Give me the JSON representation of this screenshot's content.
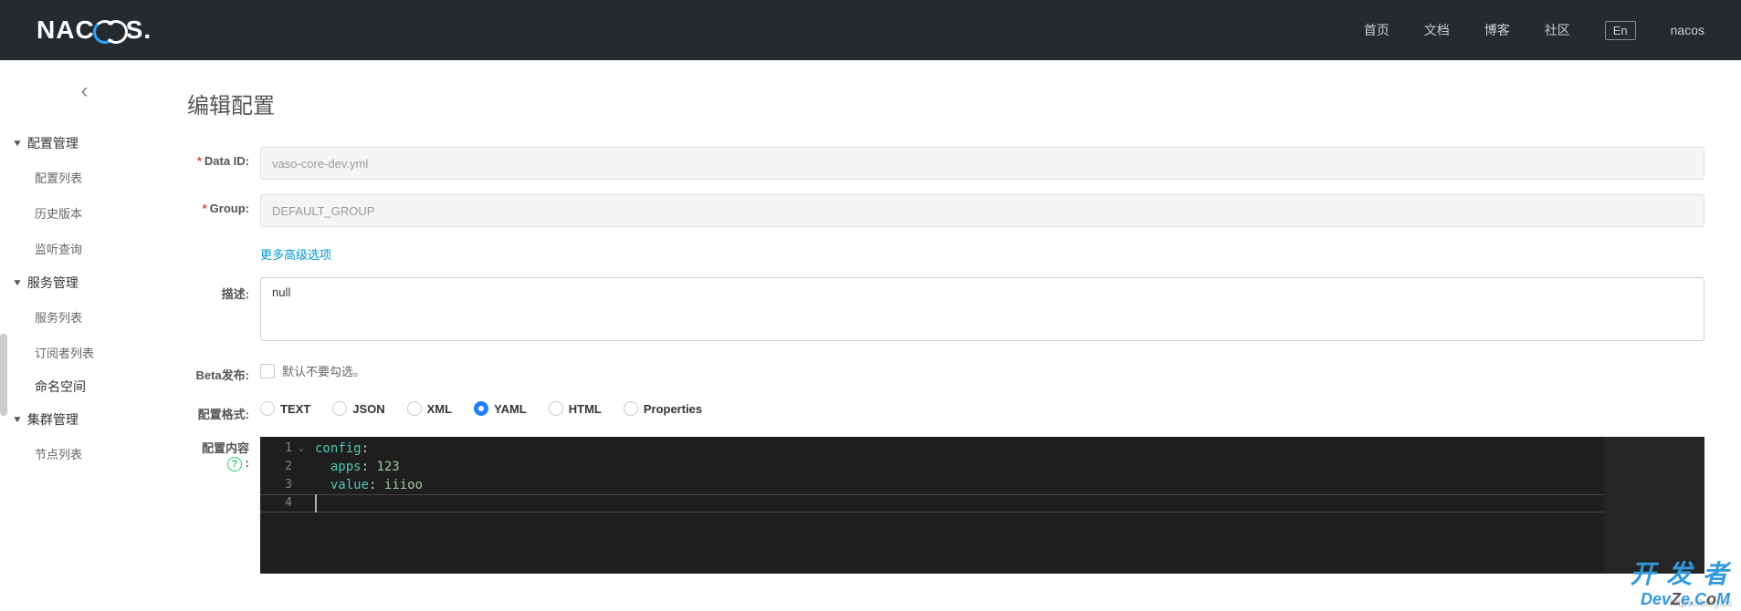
{
  "header": {
    "logo": "NACOS.",
    "nav": {
      "home": "首页",
      "docs": "文档",
      "blog": "博客",
      "community": "社区"
    },
    "lang": "En",
    "user": "nacos"
  },
  "sidebar": {
    "groups": [
      {
        "title": "配置管理",
        "items": [
          "配置列表",
          "历史版本",
          "监听查询"
        ]
      },
      {
        "title": "服务管理",
        "items": [
          "服务列表",
          "订阅者列表"
        ]
      }
    ],
    "namespace": "命名空间",
    "cluster": {
      "title": "集群管理",
      "items": [
        "节点列表"
      ]
    }
  },
  "page": {
    "title": "编辑配置",
    "labels": {
      "dataId": "Data ID:",
      "group": "Group:",
      "advanced": "更多高级选项",
      "desc": "描述:",
      "beta": "Beta发布:",
      "betaHint": "默认不要勾选。",
      "format": "配置格式:",
      "content": "配置内容"
    },
    "values": {
      "dataId": "vaso-core-dev.yml",
      "group": "DEFAULT_GROUP",
      "desc": "null"
    },
    "formats": [
      "TEXT",
      "JSON",
      "XML",
      "YAML",
      "HTML",
      "Properties"
    ],
    "formatSelected": "YAML",
    "editorLines": [
      [
        [
          "config",
          "tok-key"
        ],
        [
          ":",
          "tok-colon"
        ]
      ],
      [
        [
          "  apps",
          "tok-key"
        ],
        [
          ":",
          "tok-colon"
        ],
        [
          " ",
          ""
        ],
        [
          "123",
          "tok-num"
        ]
      ],
      [
        [
          "  value",
          "tok-key"
        ],
        [
          ":",
          "tok-colon"
        ],
        [
          " ",
          ""
        ],
        [
          "iiioo",
          "tok-str"
        ]
      ],
      []
    ]
  },
  "watermark": {
    "url": "https://blog.cs",
    "cn": "开 发 者",
    "en_a": "Dev",
    "en_b": "Z",
    "en_c": "e.C",
    "en_d": "o",
    "en_e": "M"
  }
}
